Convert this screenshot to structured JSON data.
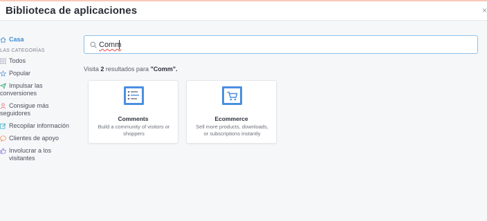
{
  "header": {
    "title": "Biblioteca de aplicaciones",
    "close_glyph": "×"
  },
  "sidebar": {
    "home": {
      "label": "Casa",
      "icon": "home-icon"
    },
    "section_label": "LAS CATEGORÍAS",
    "items": [
      {
        "label": "Todos",
        "icon": "grid-icon",
        "color": "#9aa6b5"
      },
      {
        "label": "Popular",
        "icon": "star-icon",
        "color": "#6a9fe0"
      },
      {
        "label_line1": "Impulsar las",
        "label_line2": "conversiones",
        "icon": "paper-plane-icon",
        "color": "#3db37b"
      },
      {
        "label_line1": "Consigue más",
        "label_line2": "seguidores",
        "icon": "user-icon",
        "color": "#e36a6a"
      },
      {
        "label": "Recopilar información",
        "icon": "edit-icon",
        "color": "#39b0c8"
      },
      {
        "label": "Clientes de apoyo",
        "icon": "chat-bubble-icon",
        "color": "#f2894a"
      },
      {
        "label": "Involucrar a los visitantes",
        "icon": "thumbs-up-icon",
        "color": "#8a7ad8"
      }
    ]
  },
  "search": {
    "value": "Comm",
    "icon": "search-icon"
  },
  "results": {
    "prefix": "Visita",
    "count": "2",
    "middle": "resultados para",
    "query": "\"Comm\"."
  },
  "apps": [
    {
      "title": "Comments",
      "description": "Build a community of visitors or shoppers",
      "icon": "comments-app-icon"
    },
    {
      "title": "Ecommerce",
      "description": "Sell more products, downloads, or subscriptions instantly",
      "icon": "shopping-cart-icon"
    }
  ],
  "colors": {
    "accent": "#3b8fd6",
    "search_border": "#8fc1e8",
    "top_line": "#f7c9b9",
    "app_icon_blue": "#4a8fe0"
  }
}
